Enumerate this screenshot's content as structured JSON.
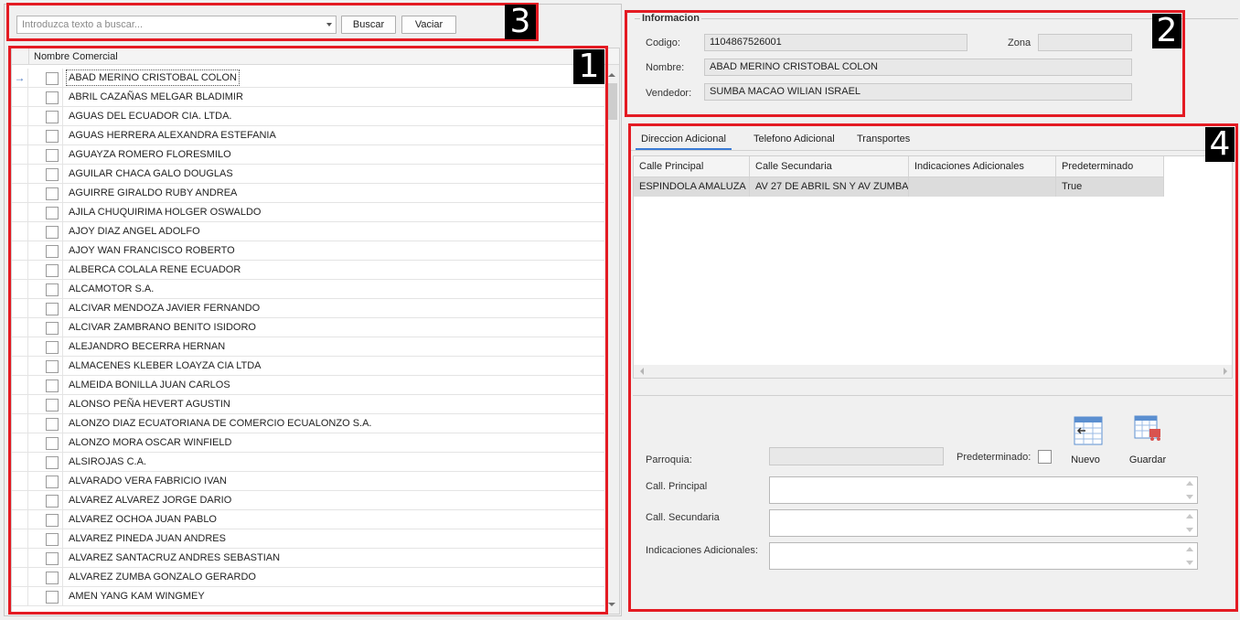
{
  "search": {
    "placeholder": "Introduzca texto a buscar...",
    "buscar_label": "Buscar",
    "vaciar_label": "Vaciar"
  },
  "grid": {
    "column_header": "Nombre Comercial",
    "current_row_indicator": "→",
    "rows": [
      "ABAD MERINO CRISTOBAL COLON",
      "ABRIL CAZAÑAS MELGAR BLADIMIR",
      "AGUAS DEL ECUADOR CIA. LTDA.",
      "AGUAS  HERRERA ALEXANDRA ESTEFANIA",
      "AGUAYZA ROMERO FLORESMILO",
      "AGUILAR CHACA GALO DOUGLAS",
      "AGUIRRE GIRALDO RUBY ANDREA",
      "AJILA CHUQUIRIMA HOLGER OSWALDO",
      "AJOY DIAZ ANGEL ADOLFO",
      "AJOY WAN FRANCISCO ROBERTO",
      "ALBERCA COLALA RENE ECUADOR",
      "ALCAMOTOR S.A.",
      "ALCIVAR MENDOZA JAVIER FERNANDO",
      "ALCIVAR ZAMBRANO BENITO ISIDORO",
      "ALEJANDRO BECERRA HERNAN",
      "ALMACENES KLEBER LOAYZA CIA LTDA",
      "ALMEIDA BONILLA JUAN CARLOS",
      "ALONSO PEÑA HEVERT AGUSTIN",
      "ALONZO DIAZ ECUATORIANA DE COMERCIO ECUALONZO S.A.",
      "ALONZO MORA OSCAR WINFIELD",
      "ALSIROJAS C.A.",
      "ALVARADO VERA FABRICIO IVAN",
      "ALVAREZ ALVAREZ JORGE DARIO",
      "ALVAREZ OCHOA JUAN PABLO",
      "ALVAREZ PINEDA JUAN ANDRES",
      "ALVAREZ SANTACRUZ  ANDRES SEBASTIAN",
      "ALVAREZ ZUMBA GONZALO GERARDO",
      "AMEN YANG KAM WINGMEY"
    ]
  },
  "info": {
    "title": "Informacion",
    "codigo_label": "Codigo:",
    "codigo_value": "1104867526001",
    "zona_label": "Zona",
    "zona_value": "",
    "nombre_label": "Nombre:",
    "nombre_value": "ABAD MERINO CRISTOBAL COLON",
    "vendedor_label": "Vendedor:",
    "vendedor_value": "SUMBA MACAO WILIAN ISRAEL"
  },
  "tabs": [
    "Direccion Adicional",
    "Telefono Adicional",
    "Transportes"
  ],
  "address_grid": {
    "columns": [
      "Calle Principal",
      "Calle Secundaria",
      "Indicaciones Adicionales",
      "Predeterminado"
    ],
    "rows": [
      [
        "ESPINDOLA  AMALUZA",
        "AV 27 DE ABRIL SN Y AV ZUMBA",
        "",
        "True"
      ]
    ]
  },
  "form": {
    "parroquia_label": "Parroquia:",
    "predeterminado_label": "Predeterminado:",
    "call_principal_label": "Call. Principal",
    "call_secundaria_label": "Call. Secundaria",
    "indicaciones_label": "Indicaciones Adicionales:",
    "nuevo_label": "Nuevo",
    "guardar_label": "Guardar"
  },
  "annotations": [
    "1",
    "2",
    "3",
    "4"
  ],
  "colors": {
    "annotation_red": "#e41b23",
    "tab_accent": "#3a7bd5"
  }
}
